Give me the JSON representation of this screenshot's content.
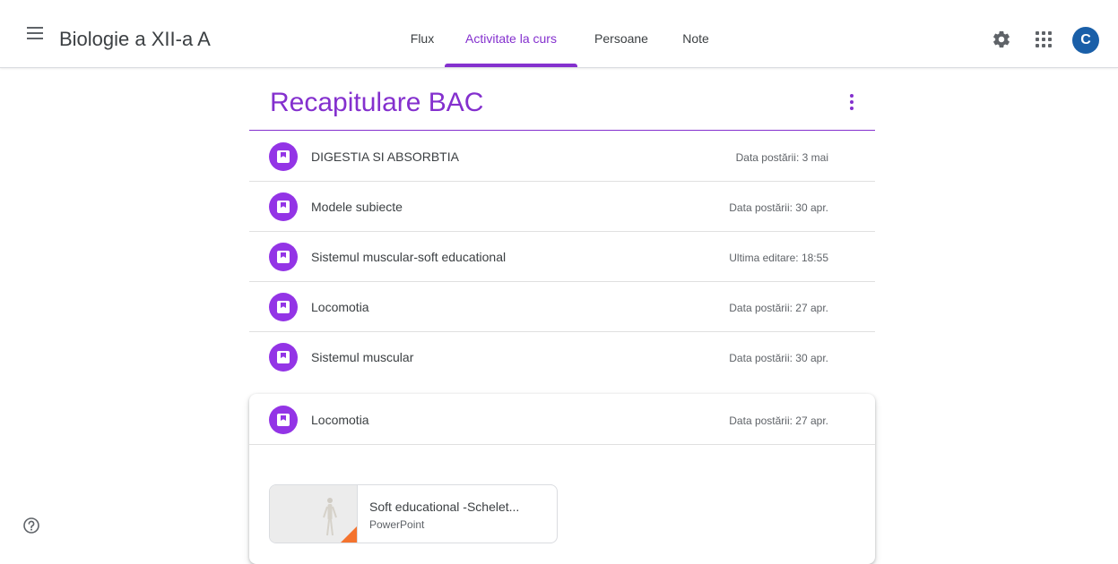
{
  "header": {
    "title": "Biologie a XII-a A",
    "avatar_letter": "C",
    "tabs": [
      {
        "label": "Flux"
      },
      {
        "label": "Activitate la curs"
      },
      {
        "label": "Persoane"
      },
      {
        "label": "Note"
      }
    ]
  },
  "topic": {
    "title": "Recapitulare BAC",
    "items": [
      {
        "name": "DIGESTIA SI ABSORBTIA",
        "date": "Data postării: 3 mai"
      },
      {
        "name": "Modele subiecte",
        "date": "Data postării: 30 apr."
      },
      {
        "name": "Sistemul muscular-soft educational",
        "date": "Ultima editare: 18:55"
      },
      {
        "name": "Locomotia",
        "date": "Data postării: 27 apr."
      },
      {
        "name": "Sistemul muscular",
        "date": "Data postării: 30 apr."
      }
    ]
  },
  "expanded": {
    "name": "Locomotia",
    "date": "Data postării: 27 apr.",
    "attachment": {
      "title": "Soft educational -Schelet...",
      "type": "PowerPoint"
    }
  },
  "colors": {
    "accent": "#8430ce",
    "material_icon": "#9334e6",
    "avatar": "#1a5fa8"
  },
  "icons": {
    "menu": "hamburger-menu-icon",
    "settings": "gear-icon",
    "apps": "google-apps-grid-icon",
    "material": "book-material-icon",
    "more": "vertical-dots-icon",
    "help": "question-circle-icon"
  }
}
